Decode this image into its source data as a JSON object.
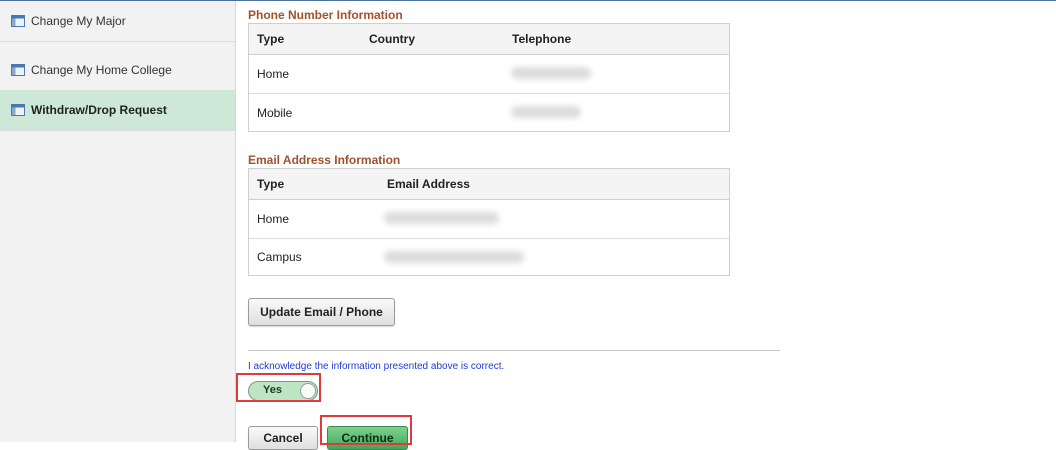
{
  "sidebar": {
    "items": [
      {
        "label": "Change My Major"
      },
      {
        "label": "Change My Home College"
      },
      {
        "label": "Withdraw/Drop Request",
        "active": true
      }
    ]
  },
  "phone": {
    "title": "Phone Number Information",
    "headers": {
      "type": "Type",
      "country": "Country",
      "telephone": "Telephone"
    },
    "rows": [
      {
        "type": "Home"
      },
      {
        "type": "Mobile"
      }
    ]
  },
  "email": {
    "title": "Email Address Information",
    "headers": {
      "type": "Type",
      "address": "Email Address"
    },
    "rows": [
      {
        "type": "Home"
      },
      {
        "type": "Campus"
      }
    ]
  },
  "buttons": {
    "update": "Update Email / Phone",
    "cancel": "Cancel",
    "continue": "Continue"
  },
  "acknowledge": {
    "text": "I acknowledge the information presented above is correct.",
    "toggle_label": "Yes"
  },
  "colors": {
    "section_title": "#a0522d",
    "active_nav": "#cde8d6",
    "primary_button": "#3fa85a",
    "highlight": "#e03a3a",
    "ack_text": "#1f3bd6"
  }
}
